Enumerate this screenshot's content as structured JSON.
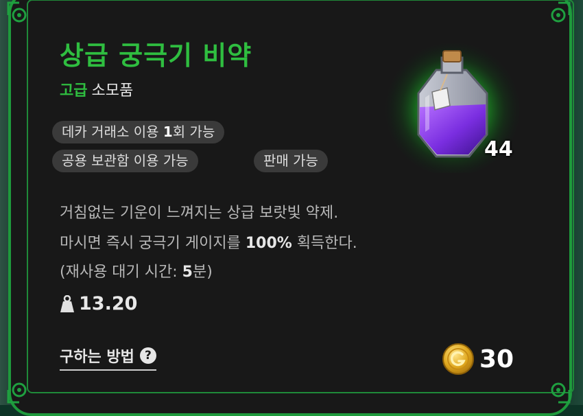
{
  "item": {
    "name": "상급 궁극기 비약",
    "grade": "고급",
    "category": "소모품",
    "stack_count": "44",
    "icon": "purple-potion-icon"
  },
  "tags": [
    {
      "pre": "데카 거래소 이용 ",
      "bold": "1",
      "post": "회 가능"
    },
    {
      "text": "공용 보관함 이용 가능"
    },
    {
      "text": "판매 가능"
    }
  ],
  "description": {
    "line1": "거침없는 기운이 느껴지는 상급 보랏빛 약제.",
    "line2_pre": "마시면 즉시 궁극기 게이지를 ",
    "line2_bold": "100%",
    "line2_post": " 획득한다.",
    "line3_pre": "(재사용 대기 시간: ",
    "line3_bold": "5",
    "line3_post": "분)"
  },
  "weight": {
    "value": "13.20",
    "icon": "weight-icon"
  },
  "acquire": {
    "label": "구하는 방법",
    "help_icon": "?"
  },
  "price": {
    "value": "30",
    "icon": "gold-coin-icon"
  },
  "colors": {
    "accent": "#2fbe40",
    "card_bg": "#181818",
    "frame": "#1e9a3c",
    "tag_bg": "#3a3a3a",
    "potion": "#7a2ee0"
  }
}
